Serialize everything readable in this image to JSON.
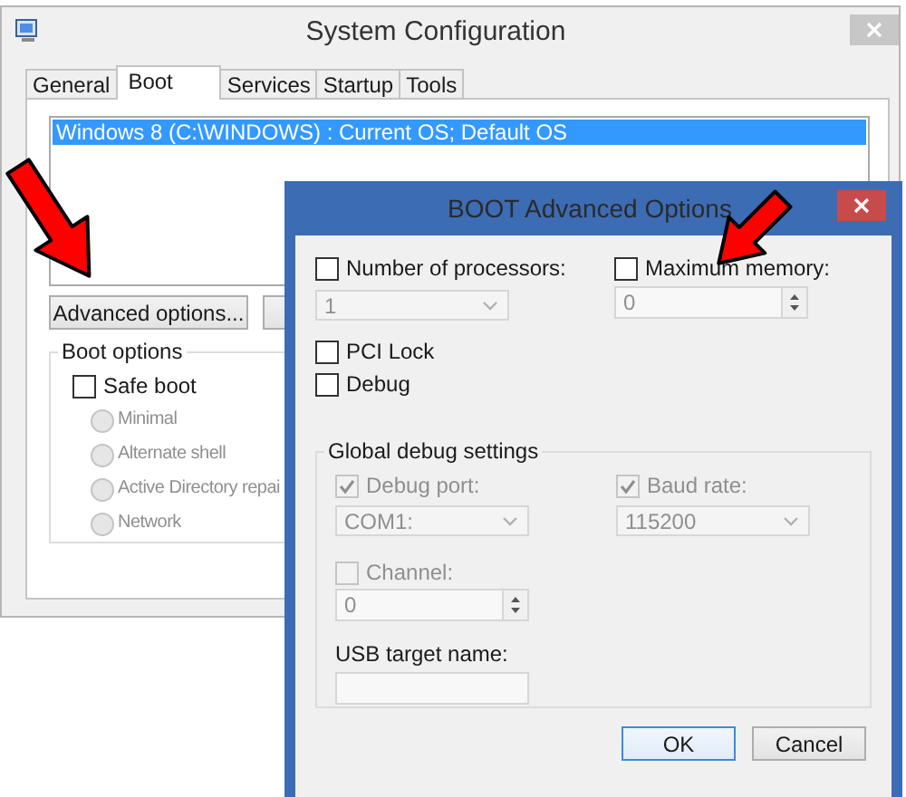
{
  "system_configuration": {
    "title": "System Configuration",
    "tabs": [
      {
        "label": "General",
        "selected": false
      },
      {
        "label": "Boot",
        "selected": true
      },
      {
        "label": "Services",
        "selected": false
      },
      {
        "label": "Startup",
        "selected": false
      },
      {
        "label": "Tools",
        "selected": false
      }
    ],
    "boot_entries": [
      {
        "label": "Windows 8 (C:\\WINDOWS) : Current OS; Default OS",
        "selected": true
      }
    ],
    "buttons": [
      {
        "label": "Advanced options..."
      }
    ],
    "boot_options": {
      "title": "Boot options",
      "safe_boot": {
        "label": "Safe boot",
        "checked": false
      },
      "modes": [
        {
          "label": "Minimal",
          "selected": false,
          "disabled": true
        },
        {
          "label": "Alternate shell",
          "selected": false,
          "disabled": true
        },
        {
          "label": "Active Directory repai",
          "selected": false,
          "disabled": true
        },
        {
          "label": "Network",
          "selected": false,
          "disabled": true
        }
      ]
    }
  },
  "advanced_dialog": {
    "title": "BOOT Advanced Options",
    "number_of_processors": {
      "label": "Number of processors:",
      "checked": false,
      "disabled": false
    },
    "processors": {
      "value": "1",
      "disabled": true
    },
    "maximum_memory": {
      "label": "Maximum memory:",
      "checked": false,
      "disabled": false
    },
    "memory": {
      "value": "0",
      "disabled": true
    },
    "pci_lock": {
      "label": "PCI Lock",
      "checked": false,
      "disabled": false
    },
    "debug": {
      "label": "Debug",
      "checked": false,
      "disabled": false
    },
    "global_debug": {
      "title": "Global debug settings",
      "debug_port": {
        "label": "Debug port:",
        "checked": true,
        "disabled": true
      },
      "port": {
        "value": "COM1:",
        "disabled": true
      },
      "baud_rate": {
        "label": "Baud rate:",
        "checked": true,
        "disabled": true
      },
      "baud": {
        "value": "115200",
        "disabled": true
      },
      "channel": {
        "label": "Channel:",
        "checked": false,
        "disabled": true
      },
      "channel_value": {
        "value": "0",
        "disabled": true
      },
      "usb_target_name": {
        "label": "USB target name:",
        "disabled": true
      }
    },
    "buttons": [
      {
        "label": "OK",
        "default": true
      },
      {
        "label": "Cancel",
        "default": false
      }
    ]
  }
}
